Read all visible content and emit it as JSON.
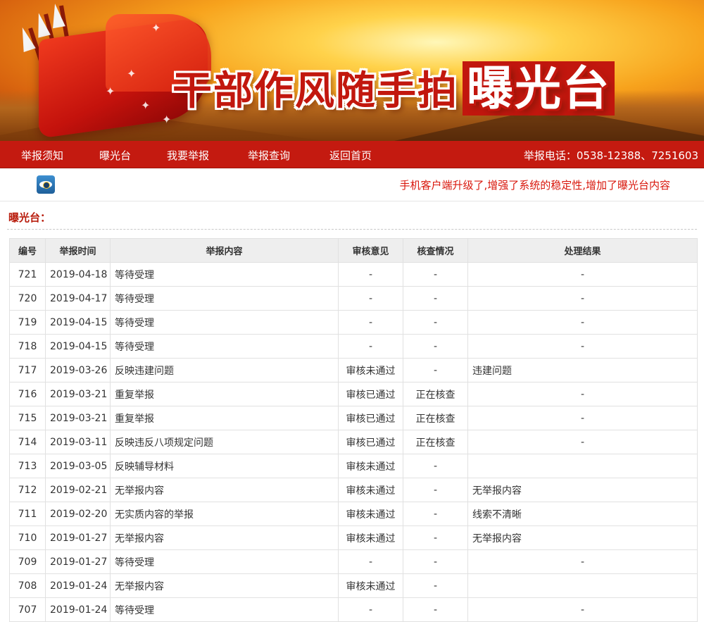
{
  "banner": {
    "title_main": "干部作风随手拍",
    "title_accent": "曝光台"
  },
  "nav": {
    "items": [
      {
        "label": "举报须知"
      },
      {
        "label": "曝光台"
      },
      {
        "label": "我要举报"
      },
      {
        "label": "举报查询"
      },
      {
        "label": "返回首页"
      }
    ],
    "hotline": "举报电话：0538-12388、7251603"
  },
  "notice": "手机客户端升级了,增强了系统的稳定性,增加了曝光台内容",
  "section_title": "曝光台：",
  "table": {
    "headers": [
      "编号",
      "举报时间",
      "举报内容",
      "审核意见",
      "核查情况",
      "处理结果"
    ],
    "rows": [
      {
        "id": "721",
        "date": "2019-04-18",
        "content": "等待受理",
        "review": "-",
        "check": "-",
        "result": "-"
      },
      {
        "id": "720",
        "date": "2019-04-17",
        "content": "等待受理",
        "review": "-",
        "check": "-",
        "result": "-"
      },
      {
        "id": "719",
        "date": "2019-04-15",
        "content": "等待受理",
        "review": "-",
        "check": "-",
        "result": "-"
      },
      {
        "id": "718",
        "date": "2019-04-15",
        "content": "等待受理",
        "review": "-",
        "check": "-",
        "result": "-"
      },
      {
        "id": "717",
        "date": "2019-03-26",
        "content": "反映违建问题",
        "review": "审核未通过",
        "check": "-",
        "result": "违建问题"
      },
      {
        "id": "716",
        "date": "2019-03-21",
        "content": "重复举报",
        "review": "审核已通过",
        "check": "正在核查",
        "result": "-"
      },
      {
        "id": "715",
        "date": "2019-03-21",
        "content": "重复举报",
        "review": "审核已通过",
        "check": "正在核查",
        "result": "-"
      },
      {
        "id": "714",
        "date": "2019-03-11",
        "content": "反映违反八项规定问题",
        "review": "审核已通过",
        "check": "正在核查",
        "result": "-"
      },
      {
        "id": "713",
        "date": "2019-03-05",
        "content": "反映辅导材料",
        "review": "审核未通过",
        "check": "-",
        "result": ""
      },
      {
        "id": "712",
        "date": "2019-02-21",
        "content": "无举报内容",
        "review": "审核未通过",
        "check": "-",
        "result": "无举报内容"
      },
      {
        "id": "711",
        "date": "2019-02-20",
        "content": "无实质内容的举报",
        "review": "审核未通过",
        "check": "-",
        "result": "线索不清晰"
      },
      {
        "id": "710",
        "date": "2019-01-27",
        "content": "无举报内容",
        "review": "审核未通过",
        "check": "-",
        "result": "无举报内容"
      },
      {
        "id": "709",
        "date": "2019-01-27",
        "content": "等待受理",
        "review": "-",
        "check": "-",
        "result": "-"
      },
      {
        "id": "708",
        "date": "2019-01-24",
        "content": "无举报内容",
        "review": "审核未通过",
        "check": "-",
        "result": ""
      },
      {
        "id": "707",
        "date": "2019-01-24",
        "content": "等待受理",
        "review": "-",
        "check": "-",
        "result": "-"
      }
    ]
  },
  "colors": {
    "nav_bg": "#c41a10",
    "accent_red": "#d9170c",
    "section_title": "#b81c0c",
    "header_bg": "#eeeeee"
  }
}
